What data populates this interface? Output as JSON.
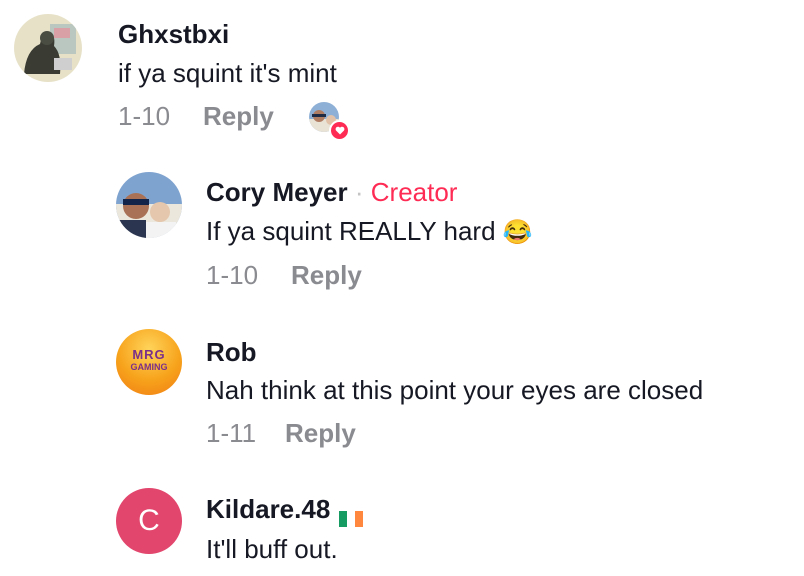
{
  "comments": [
    {
      "author": "Ghxstbxi",
      "text": "if ya squint it's mint",
      "date": "1-10",
      "reply_label": "Reply"
    },
    {
      "author": "Cory Meyer",
      "badge_separator": "·",
      "badge": "Creator",
      "text": "If ya squint REALLY hard",
      "emoji": "😂",
      "date": "1-10",
      "reply_label": "Reply"
    },
    {
      "author": "Rob",
      "avatar_text_line1": "MRG",
      "avatar_text_line2": "GAMING",
      "text": "Nah think at this point your eyes are closed",
      "date": "1-11",
      "reply_label": "Reply"
    },
    {
      "author": "Kildare.48",
      "flag": "Ireland",
      "avatar_letter": "C",
      "text": "It'll buff out."
    }
  ],
  "colors": {
    "creator_badge": "#fe2c55",
    "meta_text": "#8a8b91",
    "letter_avatar_bg": "#e2466d",
    "liked_heart": "#fe2c55"
  }
}
